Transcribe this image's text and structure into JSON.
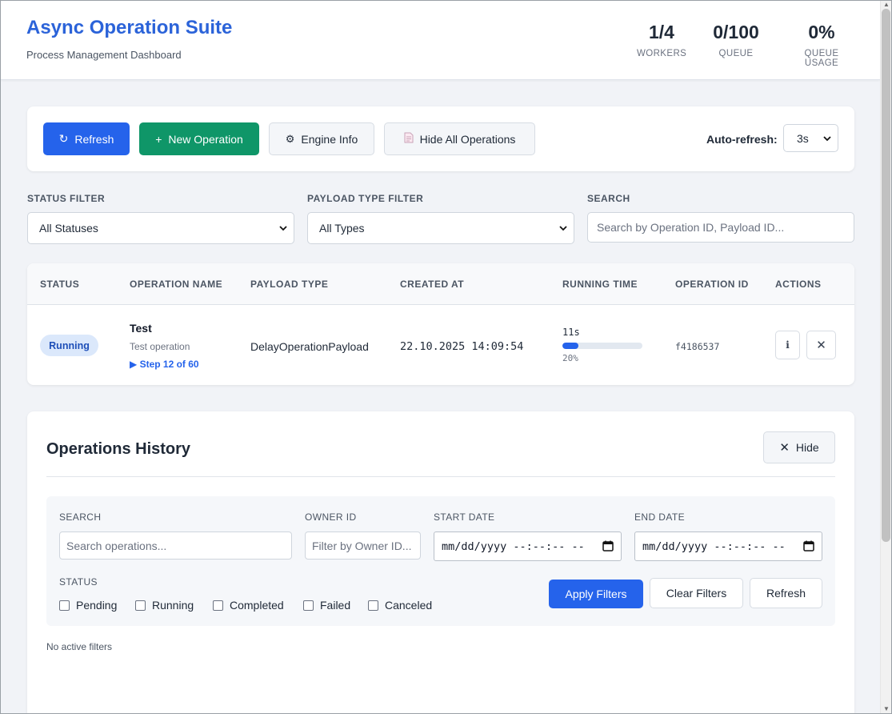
{
  "header": {
    "title": "Async Operation Suite",
    "subtitle": "Process Management Dashboard",
    "stats": [
      {
        "value": "1/4",
        "label": "WORKERS"
      },
      {
        "value": "0/100",
        "label": "QUEUE"
      },
      {
        "value": "0%",
        "label": "QUEUE USAGE"
      }
    ]
  },
  "toolbar": {
    "refresh_icon": "↻",
    "refresh_label": "Refresh",
    "new_icon": "+",
    "new_label": "New Operation",
    "engine_icon": "⚙",
    "engine_label": "Engine Info",
    "hide_ops_icon": "document-icon",
    "hide_ops_label": "Hide All Operations",
    "autorefresh_label": "Auto-refresh:",
    "autorefresh_value": "3s"
  },
  "filters": {
    "status_label": "STATUS FILTER",
    "status_value": "All Statuses",
    "payload_label": "PAYLOAD TYPE FILTER",
    "payload_value": "All Types",
    "search_label": "SEARCH",
    "search_placeholder": "Search by Operation ID, Payload ID..."
  },
  "table": {
    "columns": [
      "STATUS",
      "OPERATION NAME",
      "PAYLOAD TYPE",
      "CREATED AT",
      "RUNNING TIME",
      "OPERATION ID",
      "ACTIONS"
    ],
    "rows": [
      {
        "status": "Running",
        "name": "Test",
        "description": "Test operation",
        "step": "▶ Step 12 of 60",
        "payload_type": "DelayOperationPayload",
        "created_at": "22.10.2025 14:09:54",
        "running_time": "11s",
        "progress": 0.2,
        "progress_text": "20%",
        "operation_id": "f4186537",
        "info_icon": "i",
        "cancel_icon": "✕"
      }
    ]
  },
  "history": {
    "title": "Operations History",
    "hide_icon": "✕",
    "hide_label": "Hide",
    "search_label": "SEARCH",
    "search_placeholder": "Search operations...",
    "owner_label": "OWNER ID",
    "owner_placeholder": "Filter by Owner ID...",
    "start_label": "START DATE",
    "start_value": "mm/dd/yyyy --:--:-- --",
    "end_label": "END DATE",
    "end_value": "mm/dd/yyyy --:--:-- --",
    "status_label": "STATUS",
    "statuses": [
      "Pending",
      "Running",
      "Completed",
      "Failed",
      "Canceled"
    ],
    "apply_label": "Apply Filters",
    "clear_label": "Clear Filters",
    "refresh_label": "Refresh",
    "no_filters": "No active filters"
  },
  "colors": {
    "primary": "#2563eb",
    "success": "#0f9668",
    "title": "#2b63d9"
  }
}
